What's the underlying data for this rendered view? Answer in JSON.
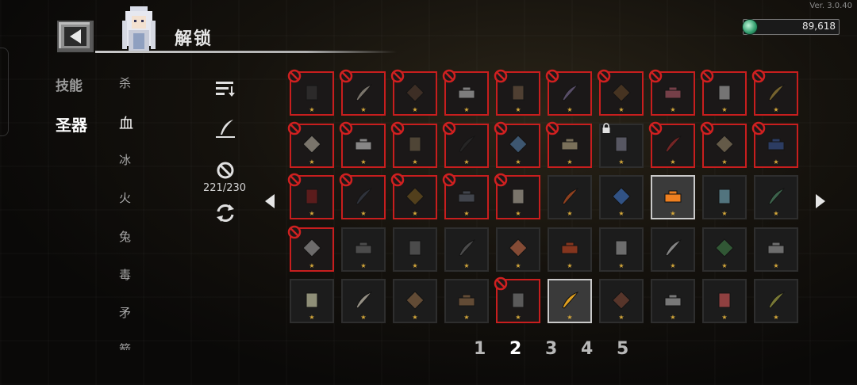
{
  "version": "Ver. 3.0.40",
  "header": {
    "title": "解锁"
  },
  "currency": {
    "value": "89,618",
    "icon": "green-gem-icon"
  },
  "categories": [
    {
      "label": "技能",
      "active": false
    },
    {
      "label": "圣器",
      "active": true
    }
  ],
  "subcategories": [
    {
      "label": "杀",
      "active": false
    },
    {
      "label": "血",
      "active": true
    },
    {
      "label": "冰",
      "active": false
    },
    {
      "label": "火",
      "active": false
    },
    {
      "label": "兔",
      "active": false
    },
    {
      "label": "毒",
      "active": false
    },
    {
      "label": "矛",
      "active": false
    },
    {
      "label": "箭",
      "active": false
    }
  ],
  "tools": {
    "counter": "221/230"
  },
  "grid": {
    "rows": [
      [
        "locked",
        "locked",
        "locked",
        "locked",
        "locked",
        "locked",
        "locked",
        "locked",
        "locked",
        "locked"
      ],
      [
        "locked",
        "locked",
        "locked",
        "locked",
        "locked",
        "locked",
        "padlock",
        "locked",
        "locked",
        "locked"
      ],
      [
        "locked",
        "locked",
        "locked",
        "locked",
        "locked",
        "normal",
        "normal",
        "selected",
        "normal",
        "normal"
      ],
      [
        "locked",
        "normal",
        "normal",
        "normal",
        "normal",
        "normal",
        "normal",
        "normal",
        "normal",
        "normal"
      ],
      [
        "normal",
        "normal",
        "normal",
        "normal",
        "locked",
        "selected",
        "normal",
        "normal",
        "normal",
        "normal"
      ]
    ],
    "items": [
      [
        "bag",
        "feather",
        "collar",
        "orb",
        "box",
        "leaf",
        "boot",
        "steak",
        "claws",
        "horn"
      ],
      [
        "feather",
        "fan",
        "gauntlet",
        "pan",
        "hat",
        "scroll",
        "statue",
        "magnet",
        "arrow",
        "shield"
      ],
      [
        "heart",
        "snake",
        "seed",
        "bird",
        "bone",
        "meat",
        "potion",
        "carrot",
        "scythe",
        "bush"
      ],
      [
        "paper",
        "rock",
        "rock",
        "rock",
        "bread",
        "ring",
        "leaves",
        "knife",
        "frog",
        "whip"
      ],
      [
        "disc",
        "feather",
        "lute",
        "lute",
        "whip",
        "pen",
        "ball",
        "chess",
        "mask",
        "lizard"
      ]
    ]
  },
  "pagination": {
    "pages": [
      "1",
      "2",
      "3",
      "4",
      "5"
    ],
    "active": "2"
  }
}
